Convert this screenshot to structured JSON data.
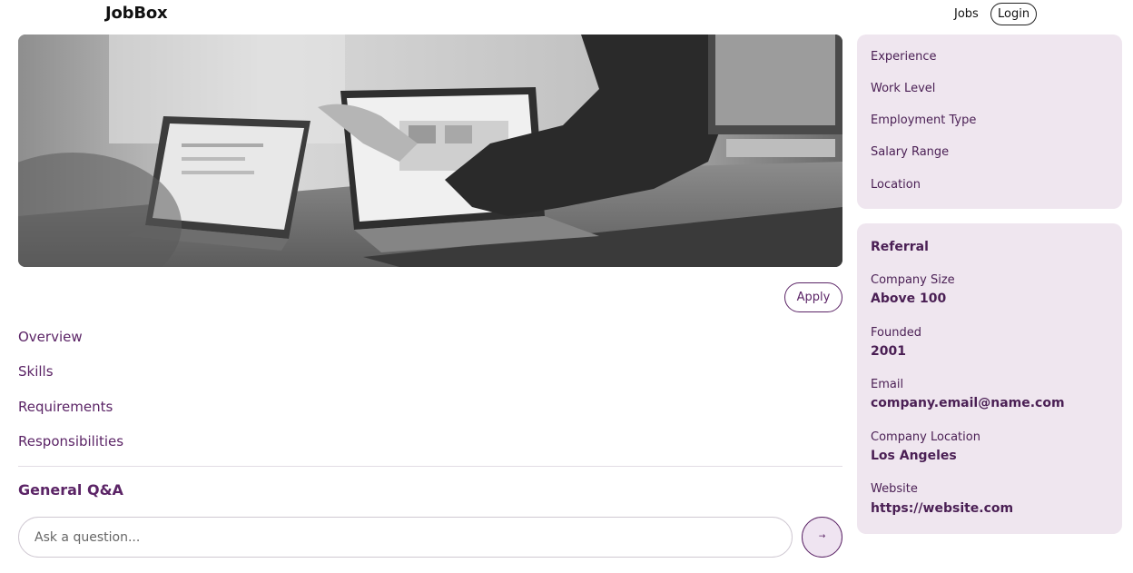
{
  "header": {
    "brand": "JobBox",
    "nav_jobs": "Jobs",
    "nav_login": "Login"
  },
  "hero": {
    "image_icon": "office-laptops-photo"
  },
  "actions": {
    "apply_label": "Apply"
  },
  "sections": [
    "Overview",
    "Skills",
    "Requirements",
    "Responsibilities"
  ],
  "qa": {
    "title": "General Q&A",
    "placeholder": "Ask a question...",
    "send_glyph": "→"
  },
  "job_details": {
    "items": [
      "Experience",
      "Work Level",
      "Employment Type",
      "Salary Range",
      "Location"
    ]
  },
  "company": {
    "heading": "Referral",
    "fields": [
      {
        "label": "Company Size",
        "value": "Above 100"
      },
      {
        "label": "Founded",
        "value": "2001"
      },
      {
        "label": "Email",
        "value": "company.email@name.com"
      },
      {
        "label": "Company Location",
        "value": "Los Angeles"
      },
      {
        "label": "Website",
        "value": "https://website.com"
      }
    ]
  },
  "colors": {
    "accent": "#5b2466",
    "card_bg": "#efe6ef"
  }
}
